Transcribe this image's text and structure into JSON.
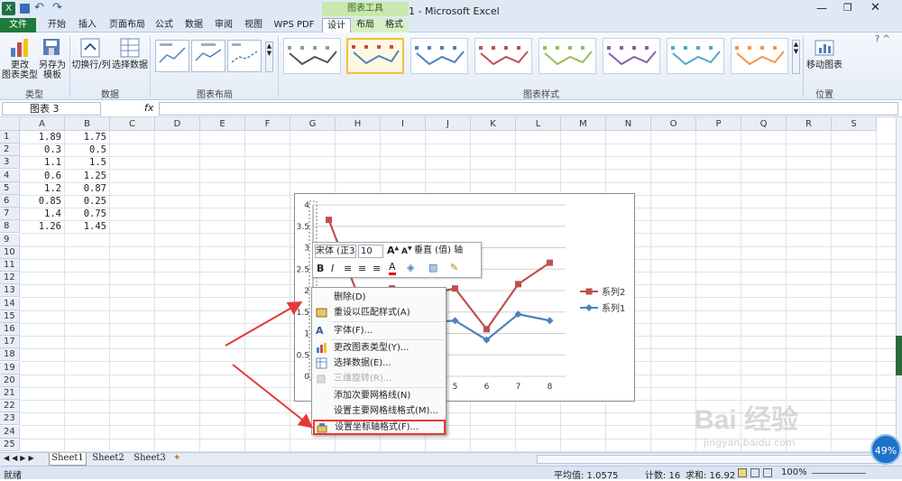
{
  "window": {
    "title": "工作簿1 - Microsoft Excel",
    "ctx_tab_group": "图表工具"
  },
  "tabs": [
    "文件",
    "开始",
    "插入",
    "页面布局",
    "公式",
    "数据",
    "审阅",
    "视图",
    "WPS PDF",
    "设计",
    "布局",
    "格式"
  ],
  "ribbon": {
    "change_type": "更改\n图表类型",
    "save_template": "另存为\n模板",
    "group_type": "类型",
    "switch_rowcol": "切换行/列",
    "select_data": "选择数据",
    "group_data": "数据",
    "group_layout": "图表布局",
    "group_styles": "图表样式",
    "move_chart": "移动图表",
    "group_location": "位置"
  },
  "formula": {
    "name_box": "图表 3",
    "fx": "fx"
  },
  "columns": [
    "A",
    "B",
    "C",
    "D",
    "E",
    "F",
    "G",
    "H",
    "I",
    "J",
    "K",
    "L",
    "M",
    "N",
    "O",
    "P",
    "Q",
    "R",
    "S"
  ],
  "rows": [
    "1",
    "2",
    "3",
    "4",
    "5",
    "6",
    "7",
    "8",
    "9",
    "10",
    "11",
    "12",
    "13",
    "14",
    "15",
    "16",
    "17",
    "18",
    "19",
    "20",
    "21",
    "22",
    "23",
    "24",
    "25"
  ],
  "cells": {
    "A": [
      "1.89",
      "0.3",
      "1.1",
      "0.6",
      "1.2",
      "0.85",
      "1.4",
      "1.26"
    ],
    "B": [
      "1.75",
      "0.5",
      "1.5",
      "1.25",
      "0.87",
      "0.25",
      "0.75",
      "1.45"
    ]
  },
  "sheets": [
    "Sheet1",
    "Sheet2",
    "Sheet3"
  ],
  "status": {
    "mode": "就绪",
    "average": "平均值: 1.0575",
    "count": "计数: 16",
    "sum": "求和: 16.92",
    "zoom": "100%",
    "badge": "49%"
  },
  "chart_data": {
    "type": "line",
    "x": [
      1,
      2,
      3,
      4,
      5,
      6,
      7,
      8
    ],
    "ylim": [
      0,
      4
    ],
    "yticks": [
      "0",
      "0.5",
      "1",
      "1.5",
      "2",
      "2.5",
      "3",
      "3.5",
      "4"
    ],
    "xticks": [
      "1",
      "2",
      "3",
      "4",
      "5",
      "6",
      "7",
      "8"
    ],
    "series": [
      {
        "name": "系列2",
        "color": "#c0504d",
        "values": [
          3.65,
          1.75,
          2.05,
          1.9,
          2.05,
          1.1,
          2.15,
          2.65
        ]
      },
      {
        "name": "系列1",
        "color": "#4f81bd",
        "values": [
          1.75,
          0.5,
          1.5,
          1.25,
          1.3,
          0.85,
          1.45,
          1.3
        ]
      }
    ],
    "legend": "right"
  },
  "mini_toolbar": {
    "font": "宋体 (正3",
    "size": "10",
    "target": "垂直 (值) 轴"
  },
  "context_menu": [
    {
      "label": "删除(D)",
      "enabled": true
    },
    {
      "label": "重设以匹配样式(A)",
      "enabled": true
    },
    {
      "label": "字体(F)...",
      "enabled": true
    },
    {
      "label": "更改图表类型(Y)...",
      "enabled": true
    },
    {
      "label": "选择数据(E)...",
      "enabled": true
    },
    {
      "label": "三维旋转(R)...",
      "enabled": false
    },
    {
      "label": "添加次要网格线(N)",
      "enabled": true
    },
    {
      "label": "设置主要网格线格式(M)...",
      "enabled": true
    },
    {
      "label": "设置坐标轴格式(F)...",
      "enabled": true
    }
  ],
  "watermark": {
    "brand": "Bai 经验",
    "url": "jingyan.baidu.com"
  }
}
